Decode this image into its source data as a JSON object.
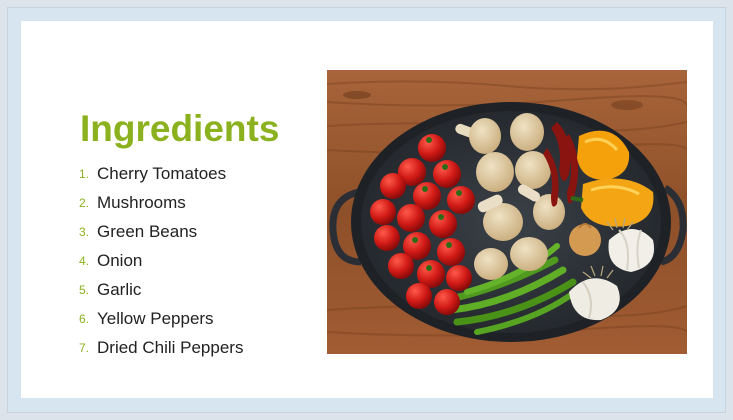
{
  "slide": {
    "title": "Ingredients",
    "items": [
      {
        "number": "1.",
        "label": "Cherry Tomatoes"
      },
      {
        "number": "2.",
        "label": "Mushrooms"
      },
      {
        "number": "3.",
        "label": "Green Beans"
      },
      {
        "number": "4.",
        "label": "Onion"
      },
      {
        "number": "5.",
        "label": "Garlic"
      },
      {
        "number": "6.",
        "label": "Yellow Peppers"
      },
      {
        "number": "7.",
        "label": "Dried Chili Peppers"
      }
    ],
    "image_icon": "vegetables-in-pan-photo"
  },
  "colors": {
    "accent": "#8cb11f",
    "text": "#222222",
    "frame": "#d6e5f0",
    "slide_bg": "#ffffff"
  }
}
